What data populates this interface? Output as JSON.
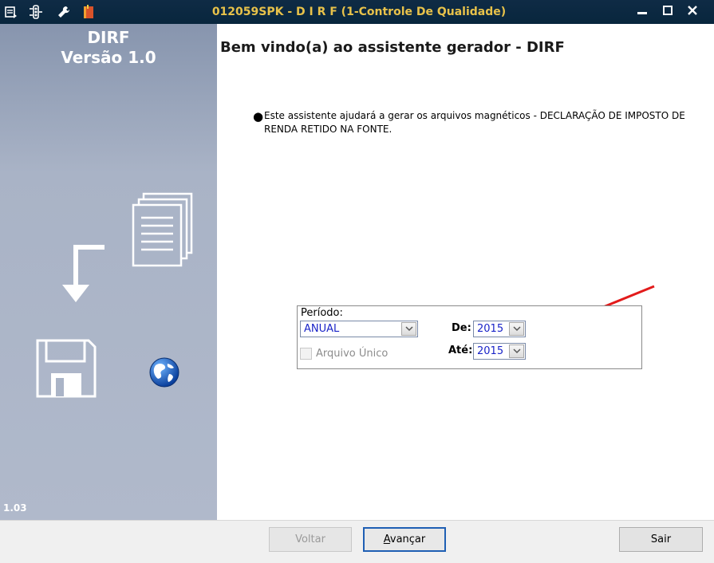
{
  "window": {
    "title": "012059SPK - D I R F (1-Controle De Qualidade)",
    "icons": [
      "menu-icon",
      "settings-icon",
      "wrench-icon",
      "book-icon"
    ],
    "controls": {
      "minimize": "▬",
      "maximize": "□",
      "close": "X"
    }
  },
  "sidebar": {
    "title_line1": "DIRF",
    "title_line2": "Versão 1.0",
    "build": "1.03"
  },
  "main": {
    "heading": "Bem vindo(a) ao assistente gerador - DIRF",
    "bullet": "●",
    "description": "Este assistente ajudará a gerar os arquivos magnéticos - DECLARAÇÃO DE IMPOSTO DE RENDA RETIDO NA FONTE.",
    "period": {
      "label": "Período:",
      "value": "ANUAL",
      "arquivo_unico_label": "Arquivo Único",
      "arquivo_unico_checked": false,
      "de_label": "De:",
      "de_value": "2015",
      "ate_label": "Até:",
      "ate_value": "2015"
    }
  },
  "footer": {
    "voltar": "Voltar",
    "avancar_prefix": "A",
    "avancar_rest": "vançar",
    "sair": "Sair"
  },
  "colors": {
    "titlebar_bg": "#0a2840",
    "title_text": "#e8c24a",
    "sidebar_bg": "#a9b3c6",
    "arrow_annotation": "#e21b1b",
    "combo_text": "#1a24c8"
  }
}
